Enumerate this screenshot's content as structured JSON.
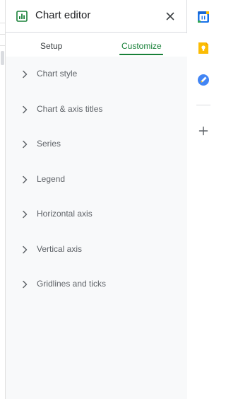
{
  "editor": {
    "title": "Chart editor",
    "close_icon": "close-icon",
    "chart_icon": "bar-chart-icon"
  },
  "tabs": [
    {
      "label": "Setup",
      "active": false
    },
    {
      "label": "Customize",
      "active": true
    }
  ],
  "sections": [
    {
      "label": "Chart style"
    },
    {
      "label": "Chart & axis titles"
    },
    {
      "label": "Series"
    },
    {
      "label": "Legend"
    },
    {
      "label": "Horizontal axis"
    },
    {
      "label": "Vertical axis"
    },
    {
      "label": "Gridlines and ticks"
    }
  ],
  "side_panel": {
    "icons": [
      "calendar-icon",
      "keep-icon",
      "tasks-icon",
      "add-icon"
    ]
  },
  "colors": {
    "accent": "#188038",
    "calendar_blue": "#1a73e8",
    "keep_yellow": "#fbbc04",
    "tasks_blue": "#4285f4"
  }
}
